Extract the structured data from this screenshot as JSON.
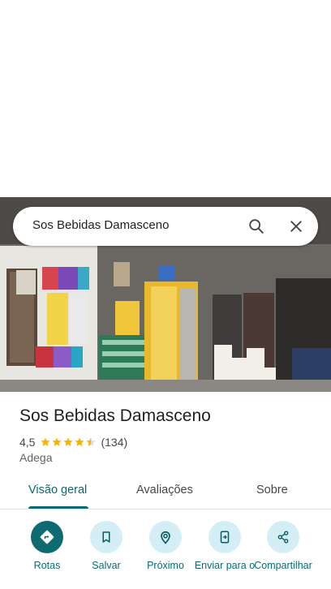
{
  "search": {
    "query": "Sos Bebidas Damasceno"
  },
  "place": {
    "name": "Sos Bebidas Damasceno",
    "rating": "4,5",
    "stars": 4.5,
    "review_count": "(134)",
    "category": "Adega"
  },
  "tabs": [
    {
      "label": "Visão geral",
      "active": true
    },
    {
      "label": "Avaliações",
      "active": false
    },
    {
      "label": "Sobre",
      "active": false
    }
  ],
  "actions": [
    {
      "label": "Rotas",
      "icon": "directions-icon"
    },
    {
      "label": "Salvar",
      "icon": "bookmark-icon"
    },
    {
      "label": "Próximo",
      "icon": "nearby-icon"
    },
    {
      "label": "Enviar para o",
      "icon": "send-to-phone-icon"
    },
    {
      "label": "Compartilhar",
      "icon": "share-icon"
    }
  ],
  "colors": {
    "accent": "#0b6b70",
    "chip": "#d3eff5",
    "star": "#f4b400"
  }
}
